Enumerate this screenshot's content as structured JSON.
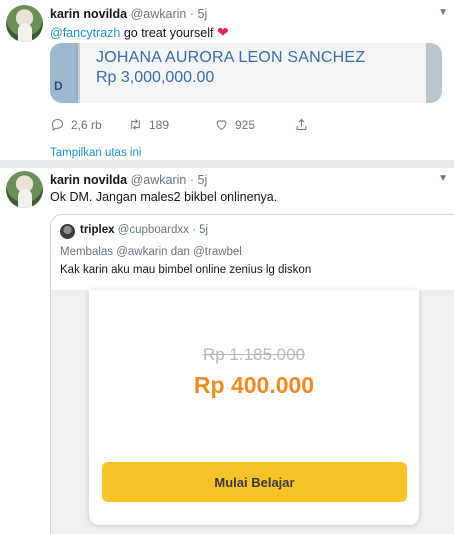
{
  "tweet1": {
    "name": "karin novilda",
    "handle": "@awkarin",
    "separator": "·",
    "time": "5j",
    "mention": "@fancytrazh",
    "text": " go treat yourself ",
    "heart": "❤",
    "media": {
      "line1": "JOHANA AURORA LEON SANCHEZ",
      "line2": "Rp 3,000,000.00",
      "edge_letter": "D"
    },
    "actions": {
      "reply_count": "2,6 rb",
      "retweet_count": "189",
      "like_count": "925"
    },
    "thread_link": "Tampilkan utas ini"
  },
  "tweet2": {
    "name": "karin novilda",
    "handle": "@awkarin",
    "separator": "·",
    "time": "5j",
    "text": "Ok DM. Jangan males2 bikbel onlinenya.",
    "quote": {
      "name": "triplex",
      "handle": "@cupboardxx",
      "separator": "·",
      "time": "5j",
      "reply_to": "Membalas @awkarin dan @trawbel",
      "text": "Kak karin aku mau bimbel online zenius lg diskon",
      "promo": {
        "old_price": "Rp 1.185.000",
        "new_price": "Rp 400.000",
        "cta": "Mulai Belajar"
      }
    }
  },
  "icons": [
    "reply-icon",
    "retweet-icon",
    "like-icon",
    "share-icon",
    "caret-down-icon"
  ],
  "colors": {
    "link": "#1b95e0",
    "muted": "#657786",
    "heart": "#e0245e",
    "price": "#f08a24",
    "cta": "#f7c329"
  }
}
